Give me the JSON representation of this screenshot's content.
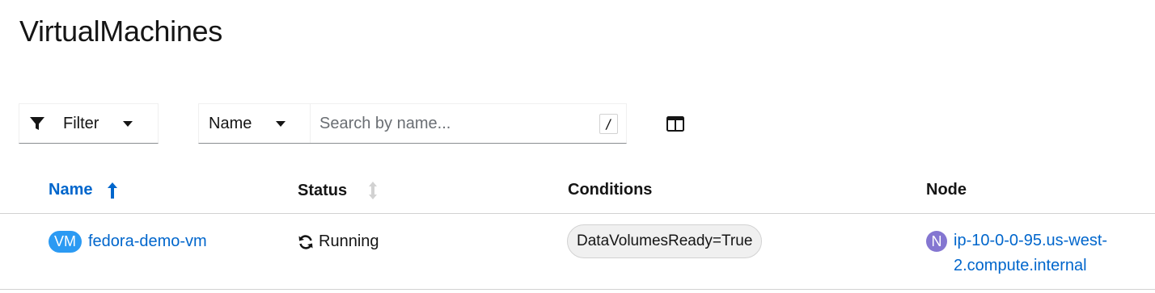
{
  "page": {
    "title": "VirtualMachines"
  },
  "toolbar": {
    "filter_label": "Filter",
    "search_type": "Name",
    "search_placeholder": "Search by name...",
    "search_value": "",
    "kbd_hint": "/"
  },
  "table": {
    "columns": [
      {
        "label": "Name",
        "sort": "ascending"
      },
      {
        "label": "Status",
        "sort": "sortable"
      },
      {
        "label": "Conditions"
      },
      {
        "label": "Node"
      }
    ],
    "rows": [
      {
        "badge": "VM",
        "name": "fedora-demo-vm",
        "status": "Running",
        "condition": "DataVolumesReady=True",
        "node_badge": "N",
        "node": "ip-10-0-0-95.us-west-2.compute.internal"
      }
    ]
  },
  "colors": {
    "link": "#0066cc",
    "vm_badge": "#2b9af3",
    "node_badge": "#8476d1",
    "border": "#d2d2d2"
  },
  "icons": {
    "filter": "filter-funnel-icon",
    "dropdown": "caret-down-icon",
    "columns": "manage-columns-icon",
    "sort_asc": "sort-ascending-icon",
    "sort_none": "sort-arrows-icon",
    "status": "sync-icon"
  }
}
